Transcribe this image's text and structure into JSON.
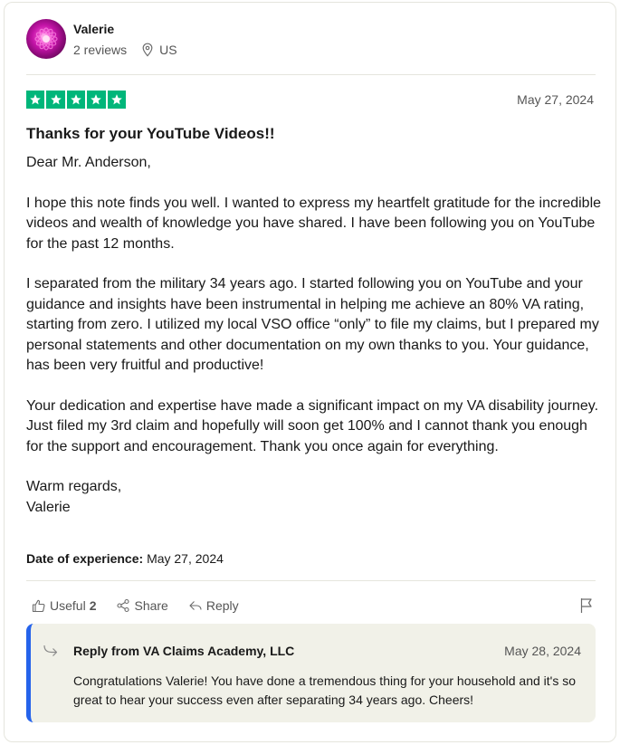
{
  "reviewer": {
    "name": "Valerie",
    "reviews_count": "2 reviews",
    "country": "US",
    "avatar": "pink-flower-avatar"
  },
  "review": {
    "rating": 5,
    "star_color": "#00b67a",
    "date": "May 27, 2024",
    "title": "Thanks for your YouTube Videos!!",
    "greeting": "Dear Mr. Anderson,",
    "paragraphs": [
      "I hope this note finds you well. I wanted to express my heartfelt gratitude for the incredible videos and wealth of knowledge you have shared. I have been following you on YouTube for the past 12 months.",
      "I separated from the military 34 years ago. I started following you on YouTube and your guidance and insights have been instrumental in helping me achieve an 80% VA rating, starting from zero. I utilized my local VSO office “only” to file my claims, but I prepared my personal statements and other documentation on my own thanks to you. Your guidance, has been very fruitful and productive!",
      "Your dedication and expertise have made a significant impact on my VA disability journey. Just filed my 3rd claim and hopefully will soon get 100% and I cannot thank you enough for the support and encouragement. Thank you once again for everything."
    ],
    "closing": "Warm regards,",
    "signature": "Valerie",
    "experience_label": "Date of experience:",
    "experience_date": "May 27, 2024"
  },
  "actions": {
    "useful_label": "Useful",
    "useful_count": "2",
    "share_label": "Share",
    "reply_label": "Reply",
    "icons": [
      "thumbs-up-icon",
      "share-icon",
      "reply-icon",
      "flag-icon"
    ]
  },
  "company_reply": {
    "title": "Reply from VA Claims Academy, LLC",
    "date": "May 28, 2024",
    "text": "Congratulations Valerie! You have done a tremendous thing for your household and it's so great to hear your success even after separating 34 years ago. Cheers!",
    "accent_color": "#2563eb"
  }
}
